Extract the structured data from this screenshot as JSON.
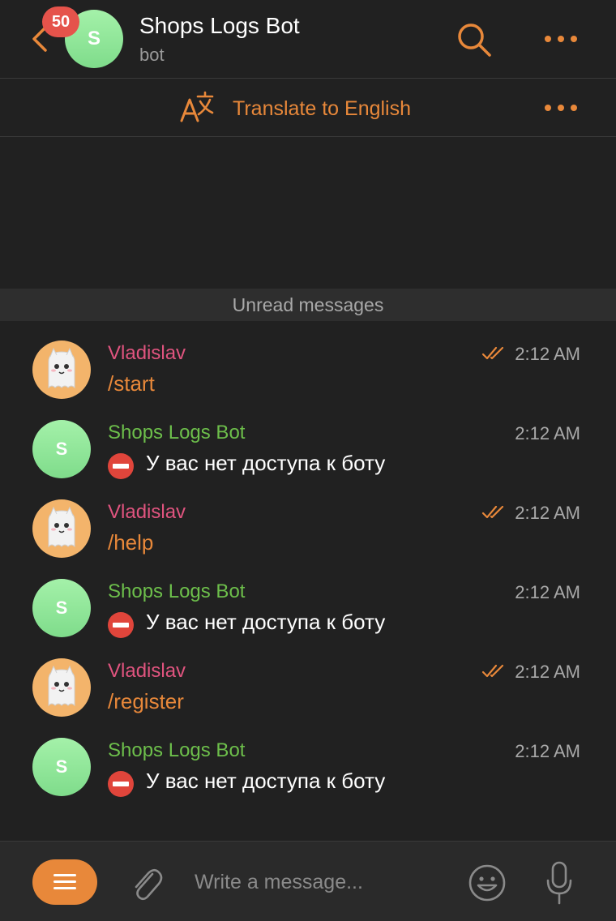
{
  "header": {
    "unread_count": "50",
    "avatar_letter": "S",
    "title": "Shops Logs Bot",
    "subtitle": "bot"
  },
  "translate": {
    "label": "Translate to English"
  },
  "unread_divider": "Unread messages",
  "messages": [
    {
      "sender": "Vladislav",
      "text": "/start",
      "time": "2:12 AM",
      "kind": "user"
    },
    {
      "sender": "Shops Logs Bot",
      "text": "У вас нет доступа к боту",
      "time": "2:12 AM",
      "kind": "bot",
      "avatar_letter": "S"
    },
    {
      "sender": "Vladislav",
      "text": "/help",
      "time": "2:12 AM",
      "kind": "user"
    },
    {
      "sender": "Shops Logs Bot",
      "text": "У вас нет доступа к боту",
      "time": "2:12 AM",
      "kind": "bot",
      "avatar_letter": "S"
    },
    {
      "sender": "Vladislav",
      "text": "/register",
      "time": "2:12 AM",
      "kind": "user"
    },
    {
      "sender": "Shops Logs Bot",
      "text": "У вас нет доступа к боту",
      "time": "2:12 AM",
      "kind": "bot",
      "avatar_letter": "S"
    }
  ],
  "composer": {
    "placeholder": "Write a message..."
  },
  "icons": {
    "back": "chevron-left-icon",
    "search": "search-icon",
    "more": "more-dots-icon",
    "translate": "translate-icon",
    "read": "double-check-icon",
    "no_entry": "no-entry-emoji",
    "menu": "bot-menu-icon",
    "attach": "paperclip-icon",
    "emoji": "smiley-icon",
    "mic": "microphone-icon"
  },
  "colors": {
    "accent": "#e8883a",
    "badge": "#e5534b",
    "user_name": "#e0547f",
    "bot_name": "#6dbf4b",
    "background": "#212121"
  }
}
